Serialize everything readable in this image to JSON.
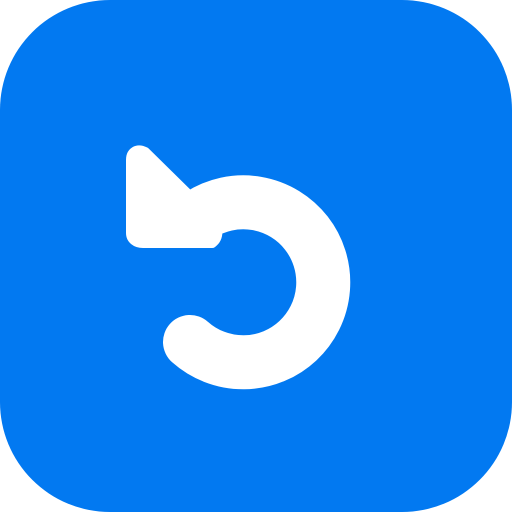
{
  "app_icon": {
    "icon": "undo-icon",
    "colors": {
      "background": "#0279f1",
      "glyph": "#ffffff"
    }
  }
}
